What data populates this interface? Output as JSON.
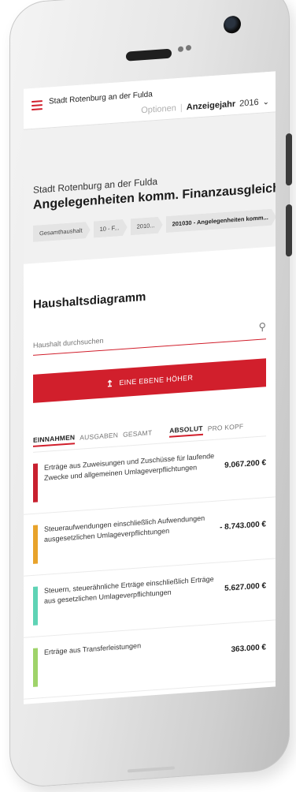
{
  "header": {
    "app_title": "Stadt Rotenburg an der Fulda",
    "options_label": "Optionen",
    "year_label": "Anzeigejahr",
    "year_value": "2016"
  },
  "hero": {
    "subtitle": "Stadt Rotenburg an der Fulda",
    "title": "Angelegenheiten komm. Finanzausgleichs",
    "breadcrumbs": [
      "Gesamthaushalt",
      "10 - F...",
      "2010...",
      "201030 - Angelegenheiten komm..."
    ]
  },
  "diagram": {
    "title": "Haushaltsdiagramm",
    "search_placeholder": "Haushalt durchsuchen",
    "up_button_label": "EINE EBENE HÖHER"
  },
  "tabs": {
    "einnahmen": "EINNAHMEN",
    "ausgaben": "AUSGABEN",
    "gesamt": "GESAMT",
    "absolut": "ABSOLUT",
    "pro_kopf": "PRO KOPF"
  },
  "items": [
    {
      "label": "Erträge aus Zuweisungen und Zuschüsse für laufende Zwecke und allgemeinen Umlageverpflichtungen",
      "value": "9.067.200 €",
      "color": "#c8202f"
    },
    {
      "label": "Steueraufwendungen einschließlich Aufwendungen ausgesetzlichen Umlageverpflichtungen",
      "value": "- 8.743.000 €",
      "color": "#e8a32b"
    },
    {
      "label": "Steuern, steuerähnliche Erträge einschließlich Erträge aus gesetzlichen Umlageverpflichtungen",
      "value": "5.627.000 €",
      "color": "#5fd3b5"
    },
    {
      "label": "Erträge aus Transferleistungen",
      "value": "363.000 €",
      "color": "#9fd36a"
    }
  ]
}
